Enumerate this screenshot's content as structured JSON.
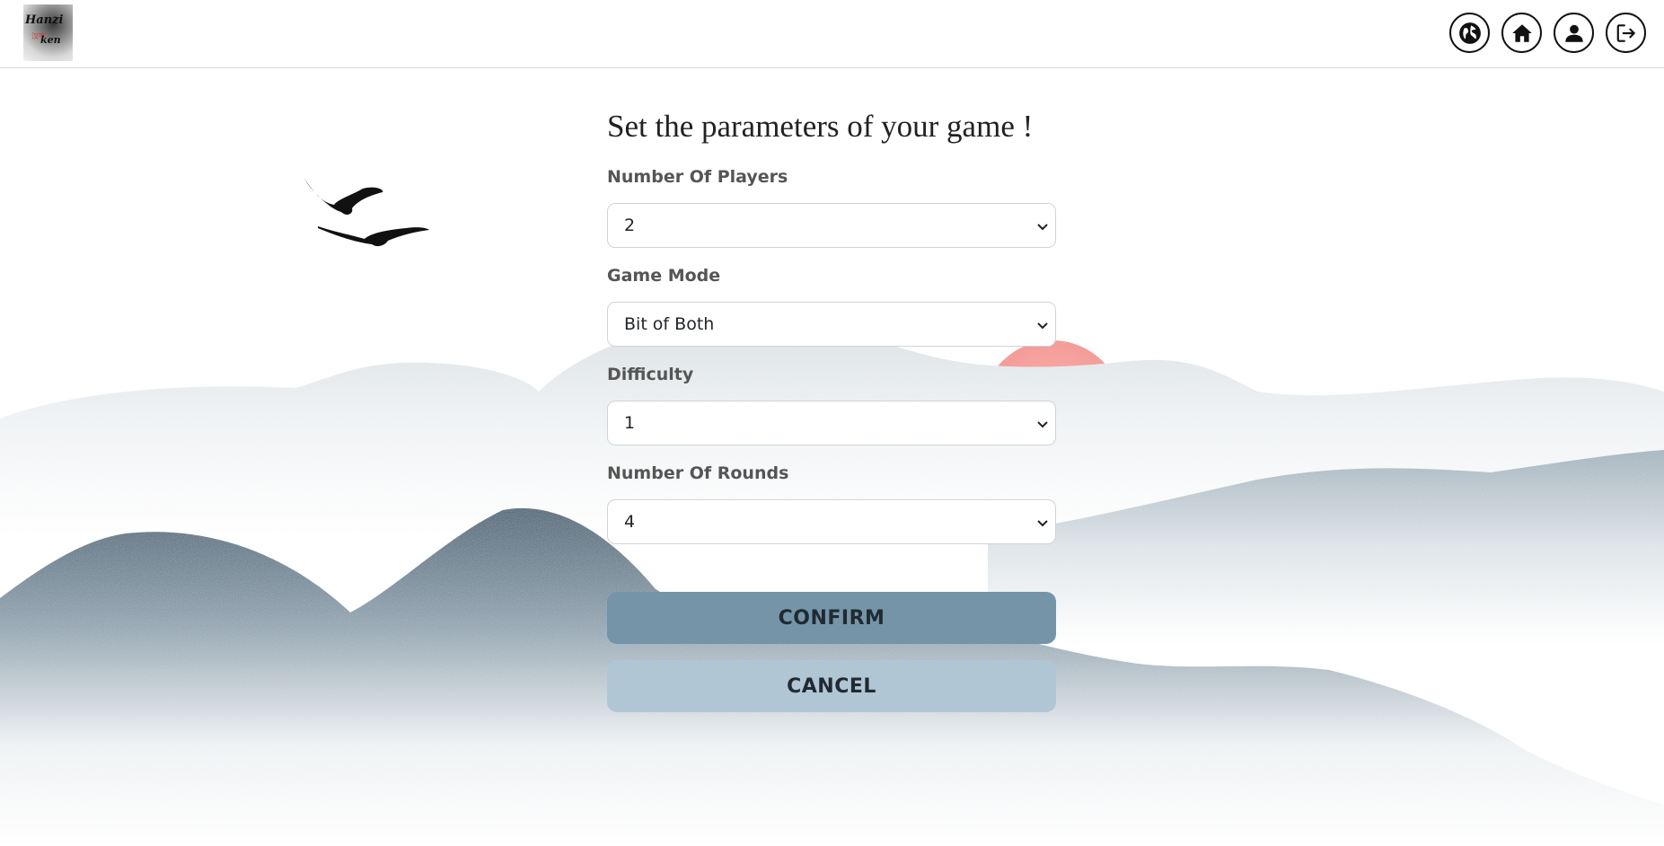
{
  "header": {
    "logo_text_line1": "Hanzi",
    "logo_text_line2": "ken",
    "logo_seal": "汉字",
    "icons": [
      "globe-icon",
      "home-icon",
      "user-icon",
      "logout-icon"
    ]
  },
  "form": {
    "title": "Set the parameters of your game !",
    "fields": [
      {
        "label": "Number Of Players",
        "value": "2"
      },
      {
        "label": "Game Mode",
        "value": "Bit of Both"
      },
      {
        "label": "Difficulty",
        "value": "1"
      },
      {
        "label": "Number Of Rounds",
        "value": "4"
      }
    ],
    "confirm_label": "CONFIRM",
    "cancel_label": "CANCEL"
  },
  "colors": {
    "confirm_bg": "#7594a8",
    "cancel_bg": "#b1c6d4",
    "sun": "#f7a6a3",
    "mountain_dark": "#4a6477",
    "mountain_light": "#d5dde2"
  }
}
